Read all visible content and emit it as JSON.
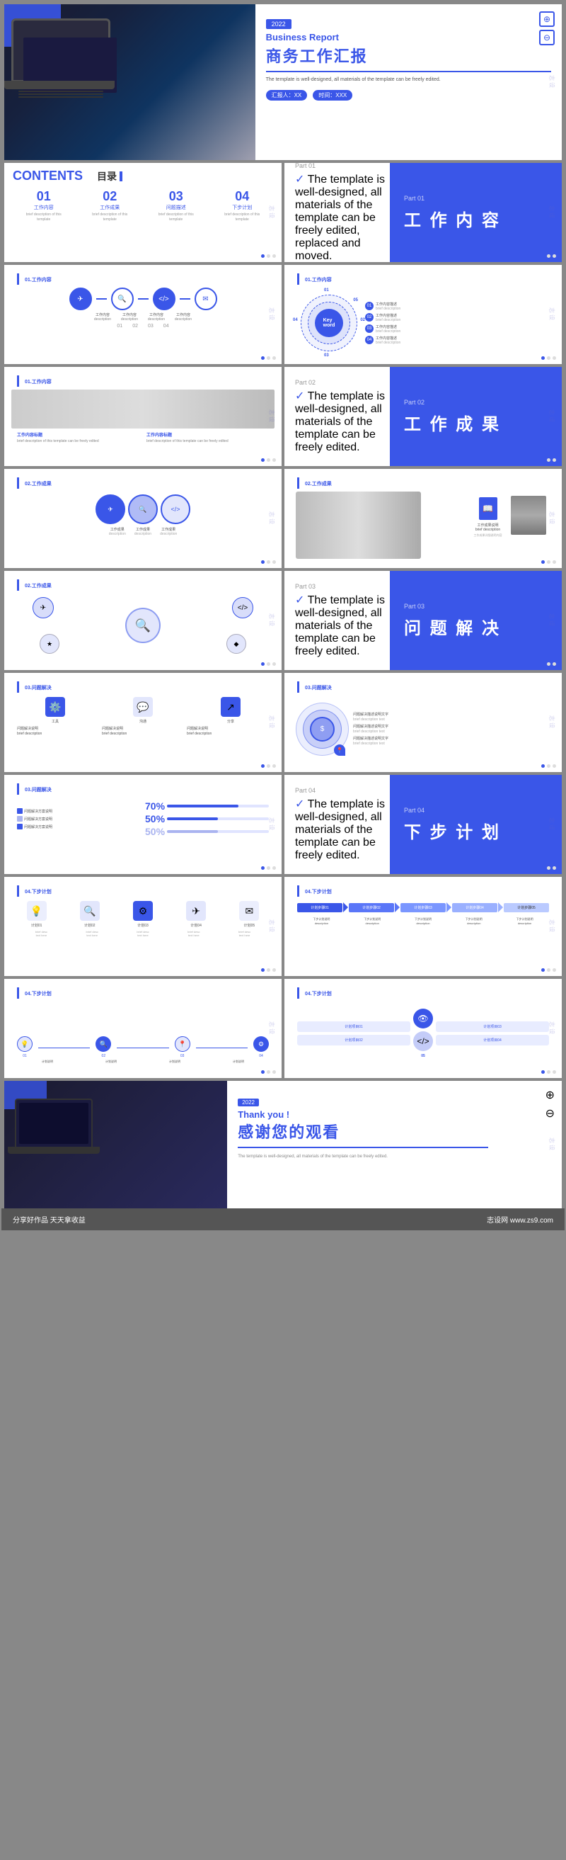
{
  "page": {
    "background": "#888888",
    "watermark": "志设网",
    "footer": {
      "left": "分享好作品 天天拿收益",
      "right": "志设网 www.zs9.com"
    }
  },
  "slide1": {
    "year": "2022",
    "title_en": "Business Report",
    "title_cn": "商务工作汇报",
    "subtitle": "The template is well-designed, all materials of the\ntemplate can be freely edited.",
    "reporter_label": "汇报人：XX",
    "time_label": "时间：XXX"
  },
  "slide2": {
    "contents_label": "CONTENTS",
    "mulu_label": "目录",
    "items": [
      {
        "num": "01",
        "label": "工作内容",
        "desc": "brief description of this\ntemplate"
      },
      {
        "num": "02",
        "label": "工作成果",
        "desc": "brief description of this\ntemplate"
      },
      {
        "num": "03",
        "label": "问题描述",
        "desc": "brief description of this\ntemplate"
      },
      {
        "num": "04",
        "label": "下步计划",
        "desc": "brief description of this\ntemplate"
      }
    ]
  },
  "slide3": {
    "part_num": "Part 01",
    "title": "工 作 内 容",
    "sub_text": "The template is well-designed, all materials of the template can be freely edited, replaced and moved."
  },
  "slide4": {
    "label": "01.工作内容",
    "circles": [
      "✈",
      "🔍",
      "</>",
      "✉"
    ],
    "nums": [
      "01",
      "02",
      "03",
      "04"
    ]
  },
  "slide5": {
    "label": "01.工作内容",
    "keyword": "Keyword",
    "items": [
      "01",
      "02",
      "03",
      "04",
      "05"
    ]
  },
  "slide6": {
    "label": "01.工作内容",
    "has_image": true
  },
  "slide7": {
    "part_num": "Part 02",
    "title": "工 作 成 果"
  },
  "slide8": {
    "label": "02.工作成果",
    "circles": [
      "✈",
      "🔍",
      "</>"
    ]
  },
  "slide9": {
    "label": "02.工作成果",
    "has_image": true
  },
  "slide10": {
    "label": "02.工作成果"
  },
  "slide11": {
    "part_num": "Part 03",
    "title": "问 题 解 决"
  },
  "slide12": {
    "label": "03.问题解决"
  },
  "slide13": {
    "label": "03.问题解决",
    "pcts": [
      {
        "label": "70%",
        "val": 70
      },
      {
        "label": "50%",
        "val": 50
      },
      {
        "label": "50%",
        "val": 50
      }
    ]
  },
  "slide14": {
    "part_num": "Part 04",
    "title": "下 步 计 划"
  },
  "slide15": {
    "label": "04.下步计划"
  },
  "slide16": {
    "label": "04.下步计划"
  },
  "slide17": {
    "label": "04.下步计划"
  },
  "slide18": {
    "label": "04.下步计划"
  },
  "slide_thanks": {
    "year": "2022",
    "title_en": "Thank you !",
    "title_cn": "感谢您的观看",
    "sub_text": "The template is well-designed, all materials of\nthe template can be freely edited."
  }
}
